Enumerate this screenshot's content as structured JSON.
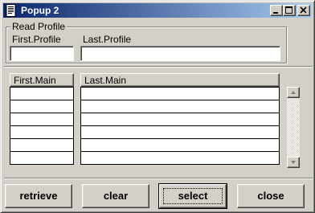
{
  "window": {
    "title": "Popup 2",
    "icon": "app-document-icon",
    "controls": {
      "minimize": "minimize-icon",
      "maximize": "maximize-icon",
      "close": "close-icon"
    }
  },
  "read_profile": {
    "group_label": "Read Profile",
    "first_label": "First.Profile",
    "last_label": "Last.Profile",
    "first_value": "",
    "last_value": ""
  },
  "grid": {
    "headers": [
      "First.Main",
      "Last.Main"
    ],
    "rows": [
      [
        "",
        ""
      ],
      [
        "",
        ""
      ],
      [
        "",
        ""
      ],
      [
        "",
        ""
      ],
      [
        "",
        ""
      ],
      [
        "",
        ""
      ]
    ]
  },
  "buttons": {
    "retrieve": "retrieve",
    "clear": "clear",
    "select": "select",
    "close": "close"
  },
  "colors": {
    "title_start": "#0a246a",
    "title_end": "#a6caf0",
    "face": "#d4d0c8"
  }
}
